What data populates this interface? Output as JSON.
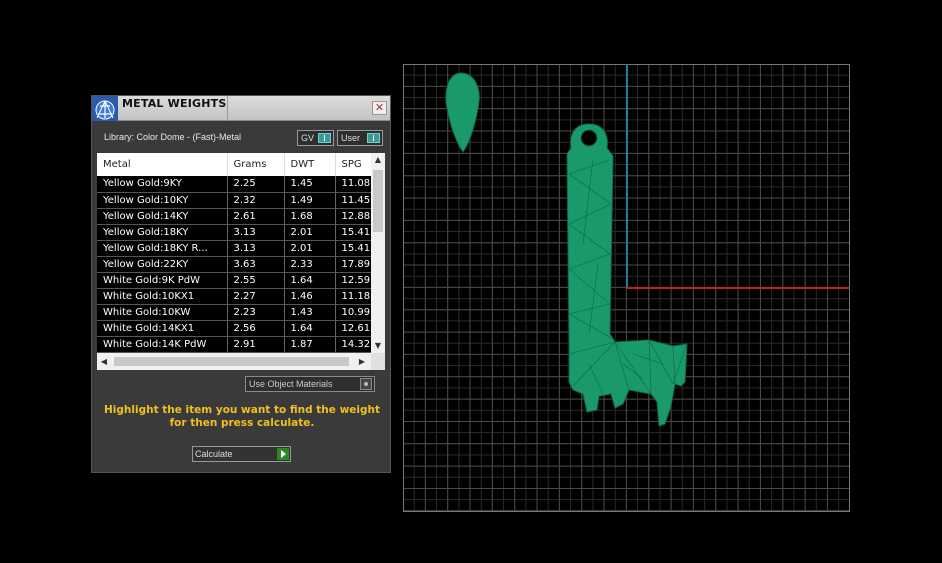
{
  "panel": {
    "title": "METAL WEIGHTS",
    "close_glyph": "✕",
    "library_label": "Library: Color Dome - (Fast)-Metal",
    "toggles": {
      "gv": "GV",
      "user": "User"
    },
    "use_object_materials": "Use Object Materials",
    "hint": "Highlight the item you want to find the weight for then press calculate.",
    "calculate": "Calculate"
  },
  "table": {
    "headers": [
      "Metal",
      "Grams",
      "DWT",
      "SPG"
    ],
    "rows": [
      [
        "Yellow Gold:9KY",
        "2.25",
        "1.45",
        "11.08"
      ],
      [
        "Yellow Gold:10KY",
        "2.32",
        "1.49",
        "11.45"
      ],
      [
        "Yellow Gold:14KY",
        "2.61",
        "1.68",
        "12.88"
      ],
      [
        "Yellow Gold:18KY",
        "3.13",
        "2.01",
        "15.41"
      ],
      [
        "Yellow Gold:18KY R...",
        "3.13",
        "2.01",
        "15.41"
      ],
      [
        "Yellow Gold:22KY",
        "3.63",
        "2.33",
        "17.89"
      ],
      [
        "White Gold:9K PdW",
        "2.55",
        "1.64",
        "12.59"
      ],
      [
        "White Gold:10KX1",
        "2.27",
        "1.46",
        "11.18"
      ],
      [
        "White Gold:10KW",
        "2.23",
        "1.43",
        "10.99"
      ],
      [
        "White Gold:14KX1",
        "2.56",
        "1.64",
        "12.61"
      ],
      [
        "White Gold:14K PdW",
        "2.91",
        "1.87",
        "14.32"
      ]
    ]
  },
  "icons": {
    "app_logo": "app-logo-icon",
    "close": "close-icon",
    "scroll_up": "▲",
    "scroll_down": "▼",
    "scroll_left": "◀",
    "scroll_right": "▶"
  },
  "colors": {
    "model": "#1a9a6a",
    "hint_text": "#f0c020",
    "axis_x": "#c02020",
    "axis_y": "#2a7aa0",
    "grid": "#4a4a4a"
  }
}
